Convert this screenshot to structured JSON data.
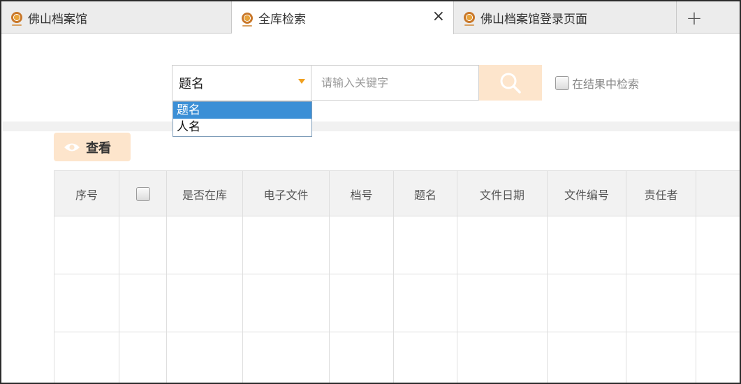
{
  "tabs": [
    {
      "label": "佛山档案馆",
      "active": false,
      "closable": false
    },
    {
      "label": "全库检索",
      "active": true,
      "closable": true
    },
    {
      "label": "佛山档案馆登录页面",
      "active": false,
      "closable": false
    }
  ],
  "tab_close_symbol": "×",
  "tab_add_symbol": "+",
  "search": {
    "field_selected": "题名",
    "field_options": [
      "题名",
      "人名"
    ],
    "keyword_placeholder": "请输入关键字",
    "keyword_value": "",
    "search_in_results_label": "在结果中检索",
    "search_in_results_checked": false
  },
  "toolbar": {
    "view_label": "查看"
  },
  "table": {
    "columns": [
      "序号",
      "",
      "是否在库",
      "电子文件",
      "档号",
      "题名",
      "文件日期",
      "文件编号",
      "责任者",
      ""
    ],
    "rows": [
      [
        "",
        "",
        "",
        "",
        "",
        "",
        "",
        "",
        "",
        ""
      ],
      [
        "",
        "",
        "",
        "",
        "",
        "",
        "",
        "",
        "",
        ""
      ],
      [
        "",
        "",
        "",
        "",
        "",
        "",
        "",
        "",
        "",
        ""
      ]
    ]
  },
  "colors": {
    "accent_light": "#fde5cc",
    "selected_option": "#3b8fd6",
    "caret": "#f0a020"
  },
  "icons": {
    "tab_icon": "archive-logo-icon",
    "search_button": "search-icon",
    "view_button": "eye-icon"
  }
}
